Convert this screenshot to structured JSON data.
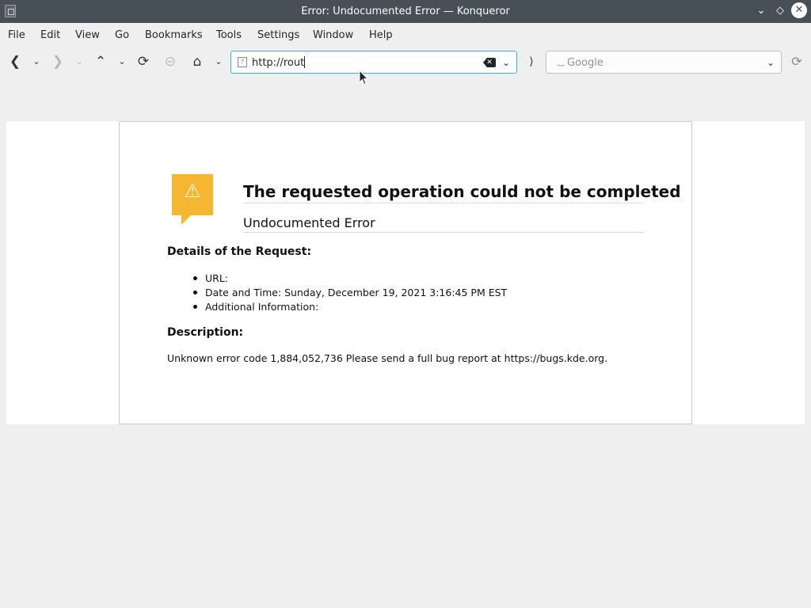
{
  "window": {
    "title": "Error: Undocumented Error — Konqueror"
  },
  "menubar": {
    "items": [
      "File",
      "Edit",
      "View",
      "Go",
      "Bookmarks",
      "Tools",
      "Settings",
      "Window",
      "Help"
    ]
  },
  "toolbar": {
    "url_value": "http://rout",
    "search_placeholder": "Google"
  },
  "error_page": {
    "title": "The requested operation could not be completed",
    "subtitle": "Undocumented Error",
    "details_heading": "Details of the Request:",
    "details": [
      "URL:",
      "Date and Time: Sunday, December 19, 2021 3:16:45 PM EST",
      "Additional Information:"
    ],
    "description_heading": "Description:",
    "description": "Unknown error code 1,884,052,736 Please send a full bug report at https://bugs.kde.org."
  },
  "colors": {
    "titlebar": "#475057",
    "accent": "#3daee9",
    "warning": "#f5b731"
  }
}
